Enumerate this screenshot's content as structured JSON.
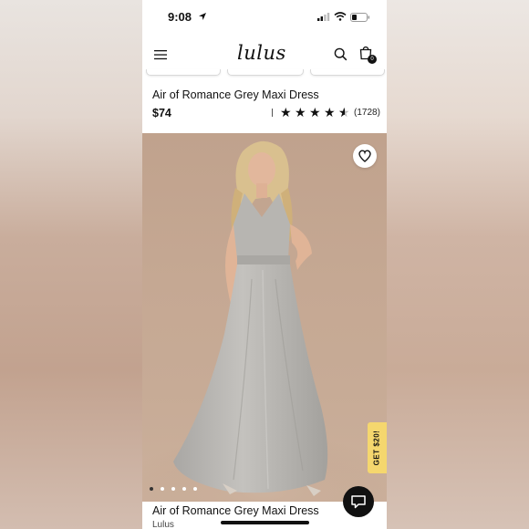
{
  "status_bar": {
    "time": "9:08"
  },
  "header": {
    "logo_text": "lulus",
    "cart_count": "0"
  },
  "product": {
    "title": "Air of Romance Grey Maxi Dress",
    "price": "$74",
    "rating": 4.5,
    "review_count": "(1728)",
    "brand": "Lulus"
  },
  "promo": {
    "label": "GET $20!",
    "color": "#f5d76e"
  },
  "carousel": {
    "total": 5,
    "active": 1
  },
  "colors": {
    "dress": "#b9b7b3",
    "background_photo": "#c5a893"
  }
}
